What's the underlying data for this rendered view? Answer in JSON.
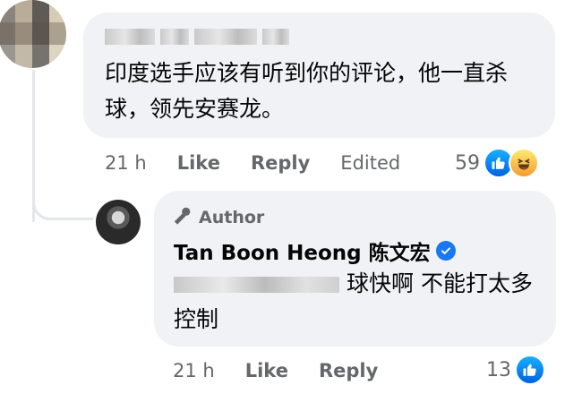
{
  "comment1": {
    "text": "印度选手应该有听到你的评论，他一直杀球，领先安赛龙。",
    "time": "21 h",
    "like_label": "Like",
    "reply_label": "Reply",
    "edited_label": "Edited",
    "reaction_count": "59"
  },
  "reply1": {
    "badge_label": "Author",
    "author": "Tan Boon Heong 陈文宏",
    "text": "球快啊 不能打太多控制",
    "time": "21 h",
    "like_label": "Like",
    "reply_label": "Reply",
    "reaction_count": "13"
  },
  "icons": {
    "like": "thumbs-up-icon",
    "haha": "laughing-face-icon",
    "author": "microphone-icon",
    "verified": "verified-check-icon"
  },
  "colors": {
    "bubble": "#f0f2f5",
    "meta_text": "#65676b",
    "like_blue": "#1877f2",
    "haha_yellow": "#f7b125"
  }
}
